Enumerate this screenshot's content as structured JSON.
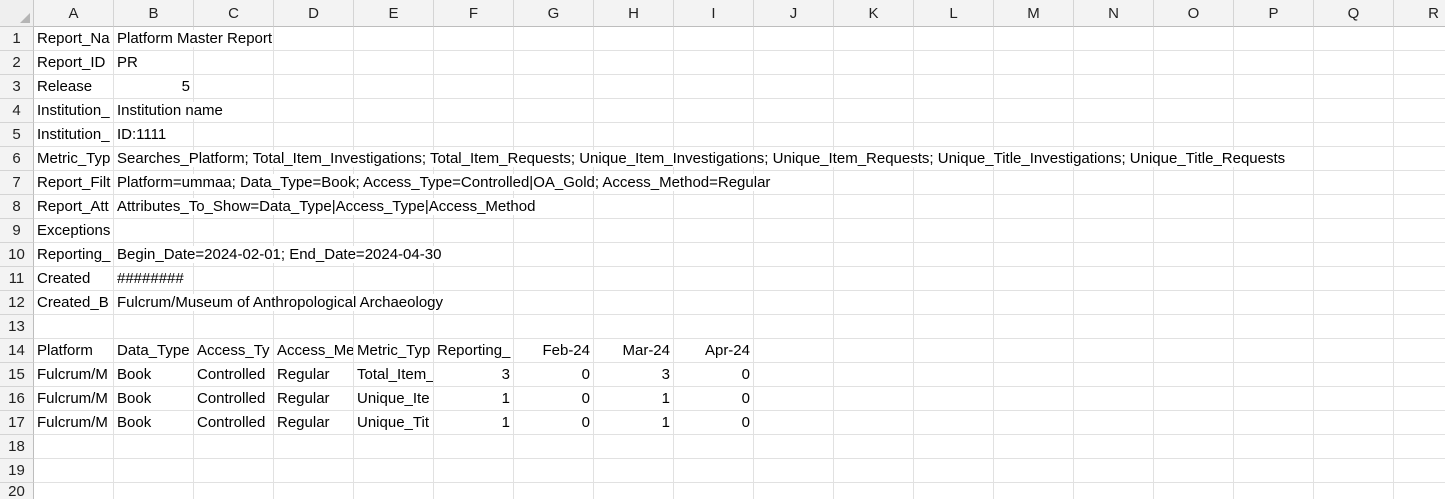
{
  "columns": [
    "A",
    "B",
    "C",
    "D",
    "E",
    "F",
    "G",
    "H",
    "I",
    "J",
    "K",
    "L",
    "M",
    "N",
    "O",
    "P",
    "Q",
    "R"
  ],
  "row_count": 20,
  "cells": [
    {
      "r": 1,
      "c": 1,
      "v": "Report_Na"
    },
    {
      "r": 1,
      "c": 2,
      "v": "Platform Master Report",
      "spill": true
    },
    {
      "r": 2,
      "c": 1,
      "v": "Report_ID"
    },
    {
      "r": 2,
      "c": 2,
      "v": "PR"
    },
    {
      "r": 3,
      "c": 1,
      "v": "Release"
    },
    {
      "r": 3,
      "c": 2,
      "v": "5",
      "num": true
    },
    {
      "r": 4,
      "c": 1,
      "v": "Institution_"
    },
    {
      "r": 4,
      "c": 2,
      "v": "Institution name",
      "spill": true
    },
    {
      "r": 5,
      "c": 1,
      "v": "Institution_"
    },
    {
      "r": 5,
      "c": 2,
      "v": "ID:1111"
    },
    {
      "r": 6,
      "c": 1,
      "v": "Metric_Typ"
    },
    {
      "r": 6,
      "c": 2,
      "v": "Searches_Platform; Total_Item_Investigations; Total_Item_Requests; Unique_Item_Investigations; Unique_Item_Requests; Unique_Title_Investigations; Unique_Title_Requests",
      "spill": true
    },
    {
      "r": 7,
      "c": 1,
      "v": "Report_Filt"
    },
    {
      "r": 7,
      "c": 2,
      "v": "Platform=ummaa; Data_Type=Book; Access_Type=Controlled|OA_Gold; Access_Method=Regular",
      "spill": true
    },
    {
      "r": 8,
      "c": 1,
      "v": "Report_Att"
    },
    {
      "r": 8,
      "c": 2,
      "v": "Attributes_To_Show=Data_Type|Access_Type|Access_Method",
      "spill": true
    },
    {
      "r": 9,
      "c": 1,
      "v": "Exceptions"
    },
    {
      "r": 10,
      "c": 1,
      "v": "Reporting_"
    },
    {
      "r": 10,
      "c": 2,
      "v": "Begin_Date=2024-02-01; End_Date=2024-04-30",
      "spill": true
    },
    {
      "r": 11,
      "c": 1,
      "v": "Created"
    },
    {
      "r": 11,
      "c": 2,
      "v": "########"
    },
    {
      "r": 12,
      "c": 1,
      "v": "Created_B"
    },
    {
      "r": 12,
      "c": 2,
      "v": "Fulcrum/Museum of Anthropological Archaeology",
      "spill": true
    },
    {
      "r": 14,
      "c": 1,
      "v": "Platform"
    },
    {
      "r": 14,
      "c": 2,
      "v": "Data_Type"
    },
    {
      "r": 14,
      "c": 3,
      "v": "Access_Ty"
    },
    {
      "r": 14,
      "c": 4,
      "v": "Access_Me"
    },
    {
      "r": 14,
      "c": 5,
      "v": "Metric_Typ"
    },
    {
      "r": 14,
      "c": 6,
      "v": "Reporting_"
    },
    {
      "r": 14,
      "c": 7,
      "v": "Feb-24",
      "num": true
    },
    {
      "r": 14,
      "c": 8,
      "v": "Mar-24",
      "num": true
    },
    {
      "r": 14,
      "c": 9,
      "v": "Apr-24",
      "num": true
    },
    {
      "r": 15,
      "c": 1,
      "v": "Fulcrum/M"
    },
    {
      "r": 15,
      "c": 2,
      "v": "Book"
    },
    {
      "r": 15,
      "c": 3,
      "v": "Controlled"
    },
    {
      "r": 15,
      "c": 4,
      "v": "Regular"
    },
    {
      "r": 15,
      "c": 5,
      "v": "Total_Item_"
    },
    {
      "r": 15,
      "c": 6,
      "v": "3",
      "num": true
    },
    {
      "r": 15,
      "c": 7,
      "v": "0",
      "num": true
    },
    {
      "r": 15,
      "c": 8,
      "v": "3",
      "num": true
    },
    {
      "r": 15,
      "c": 9,
      "v": "0",
      "num": true
    },
    {
      "r": 16,
      "c": 1,
      "v": "Fulcrum/M"
    },
    {
      "r": 16,
      "c": 2,
      "v": "Book"
    },
    {
      "r": 16,
      "c": 3,
      "v": "Controlled"
    },
    {
      "r": 16,
      "c": 4,
      "v": "Regular"
    },
    {
      "r": 16,
      "c": 5,
      "v": "Unique_Ite"
    },
    {
      "r": 16,
      "c": 6,
      "v": "1",
      "num": true
    },
    {
      "r": 16,
      "c": 7,
      "v": "0",
      "num": true
    },
    {
      "r": 16,
      "c": 8,
      "v": "1",
      "num": true
    },
    {
      "r": 16,
      "c": 9,
      "v": "0",
      "num": true
    },
    {
      "r": 17,
      "c": 1,
      "v": "Fulcrum/M"
    },
    {
      "r": 17,
      "c": 2,
      "v": "Book"
    },
    {
      "r": 17,
      "c": 3,
      "v": "Controlled"
    },
    {
      "r": 17,
      "c": 4,
      "v": "Regular"
    },
    {
      "r": 17,
      "c": 5,
      "v": "Unique_Tit"
    },
    {
      "r": 17,
      "c": 6,
      "v": "1",
      "num": true
    },
    {
      "r": 17,
      "c": 7,
      "v": "0",
      "num": true
    },
    {
      "r": 17,
      "c": 8,
      "v": "1",
      "num": true
    },
    {
      "r": 17,
      "c": 9,
      "v": "0",
      "num": true
    }
  ]
}
